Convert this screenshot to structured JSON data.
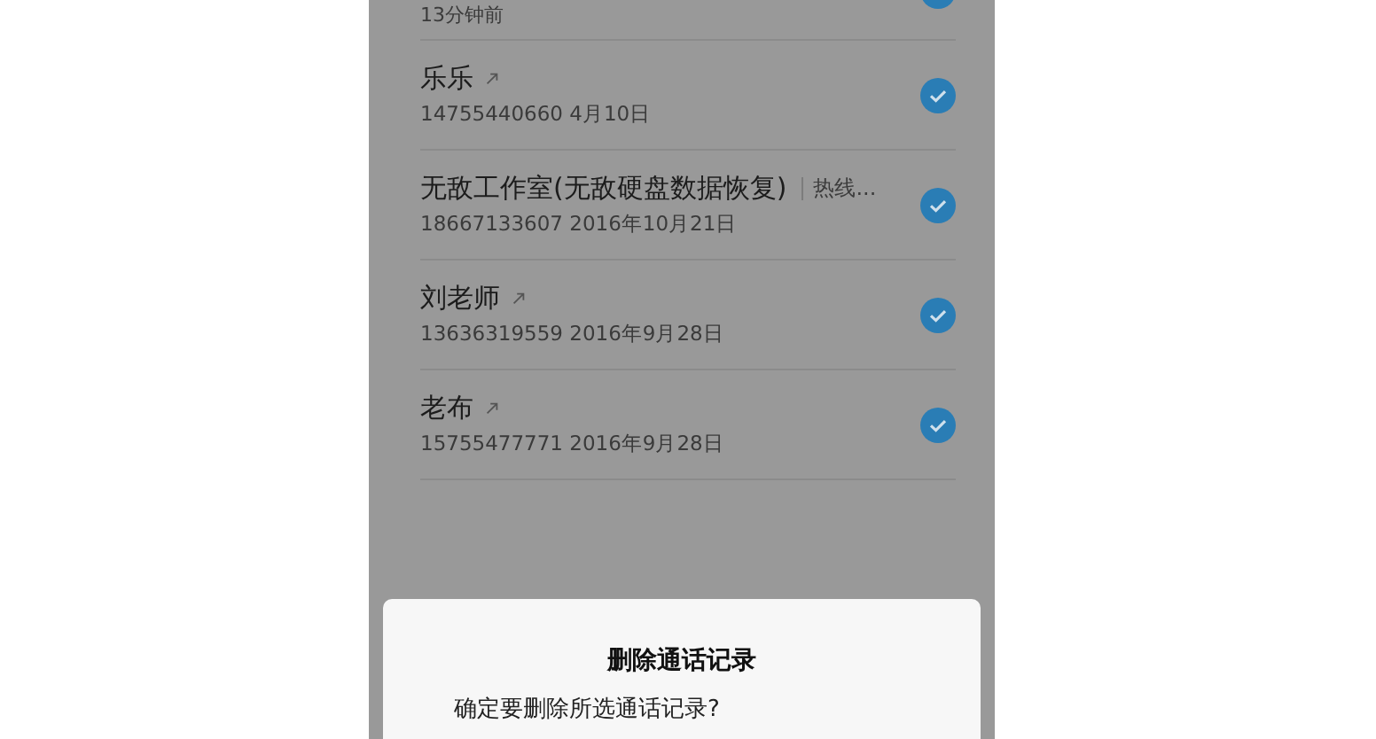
{
  "calls": [
    {
      "subtitle": "13分钟前",
      "selected": true
    },
    {
      "name": "乐乐",
      "linked": true,
      "subtitle": "14755440660 4月10日",
      "selected": true
    },
    {
      "name": "无敌工作室(无敌硬盘数据恢复)",
      "tag": "热线...",
      "subtitle": "18667133607 2016年10月21日",
      "selected": true
    },
    {
      "name": "刘老师",
      "linked": true,
      "subtitle": "13636319559 2016年9月28日",
      "selected": true
    },
    {
      "name": "老布",
      "linked": true,
      "subtitle": "15755477771 2016年9月28日",
      "selected": true
    }
  ],
  "dialog": {
    "title": "删除通话记录",
    "message": "确定要删除所选通话记录?"
  }
}
